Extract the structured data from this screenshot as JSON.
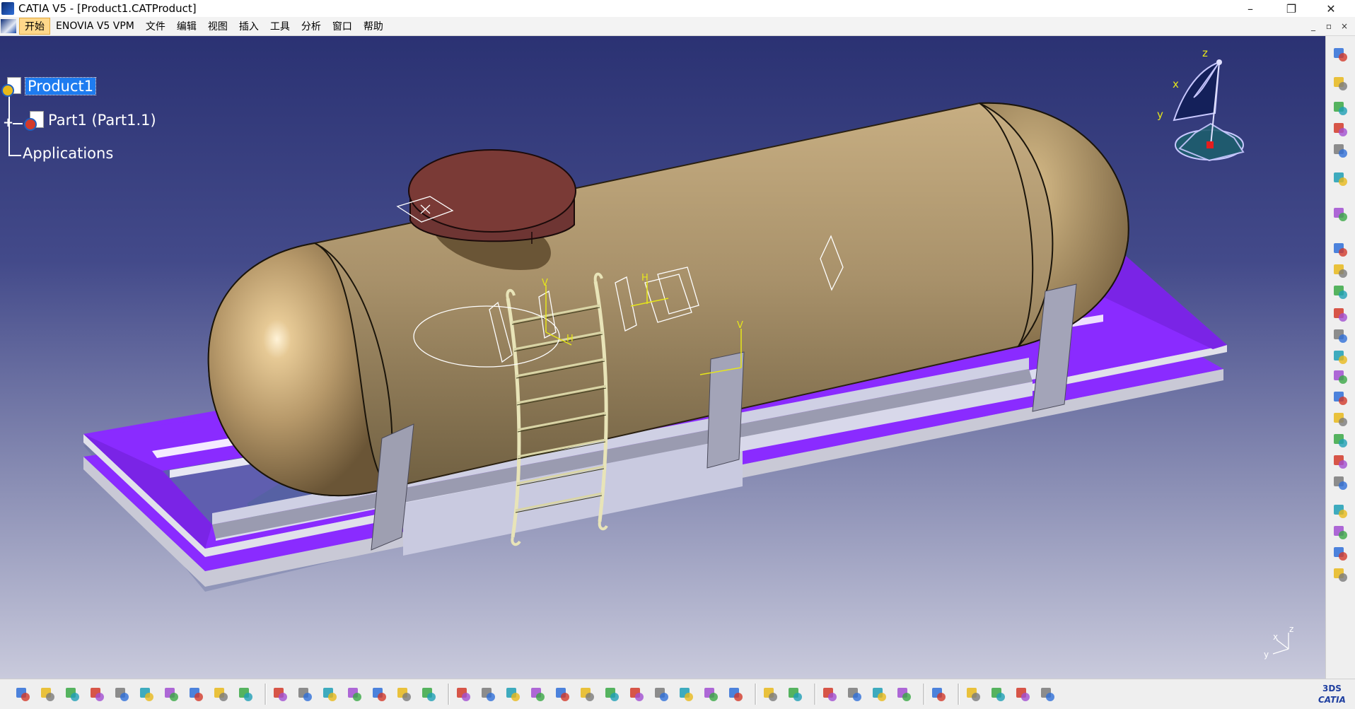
{
  "window": {
    "title": "CATIA V5 - [Product1.CATProduct]"
  },
  "window_controls": {
    "minimize": "–",
    "restore": "❐",
    "close": "✕"
  },
  "mdi_controls": {
    "minimize": "_",
    "restore": "▫",
    "close": "×"
  },
  "menu": {
    "items": [
      "开始",
      "ENOVIA V5 VPM",
      "文件",
      "编辑",
      "视图",
      "插入",
      "工具",
      "分析",
      "窗口",
      "帮助"
    ]
  },
  "tree": {
    "root": "Product1",
    "child": "Part1 (Part1.1)",
    "applications": "Applications",
    "expand_symbol": "+"
  },
  "compass": {
    "x": "x",
    "y": "y",
    "z": "z"
  },
  "mini_axis": {
    "x": "x",
    "y": "y",
    "z": "z"
  },
  "sketch_axis_labels": {
    "v": "V",
    "h": "H"
  },
  "brand": {
    "logo": "CATIA",
    "ds": "3DS"
  },
  "colors": {
    "background_top": "#2b3273",
    "background_bottom": "#c9cadc",
    "tank": "#b19a6e",
    "lid": "#6e3533",
    "base": "#8a2bff",
    "support": "#9e9fb1",
    "selection": "#1e7cf0"
  },
  "toolbar_icons_right": [
    "settings-icon",
    "sketch-icon",
    "sketch-icon",
    "sketch-icon",
    "sketch-icon",
    "select-arrow-icon",
    "snap-icon",
    "product-gear-icon",
    "product-gear-icon",
    "product-gear-icon",
    "replace-icon",
    "constraint-icon",
    "explode-icon",
    "manipulate-icon",
    "clash-icon",
    "annotate-icon",
    "tree-icon",
    "bill-icon",
    "catalog-icon",
    "scene-icon",
    "move-icon",
    "snap-move-icon",
    "smart-move-icon"
  ],
  "toolbar_icons_bottom": [
    "new-icon",
    "open-icon",
    "save-icon",
    "print-icon",
    "cut-icon",
    "copy-icon",
    "paste-icon",
    "undo-icon",
    "redo-icon",
    "help-icon",
    "formula-icon",
    "comment-icon",
    "measure-icon",
    "table-icon",
    "tree-icon",
    "view-icon",
    "view-icon",
    "fly-icon",
    "fit-all-icon",
    "pan-icon",
    "rotate-icon",
    "zoom-in-icon",
    "zoom-out-icon",
    "normal-view-icon",
    "multi-view-icon",
    "iso-view-icon",
    "shading-icon",
    "hide-icon",
    "swap-icon",
    "camera-icon",
    "catalog-icon",
    "measure-between-icon",
    "measure-item-icon",
    "inertia-icon",
    "update-icon",
    "plane-icon",
    "render-icon",
    "material-icon",
    "color-icon",
    "grid-icon"
  ]
}
